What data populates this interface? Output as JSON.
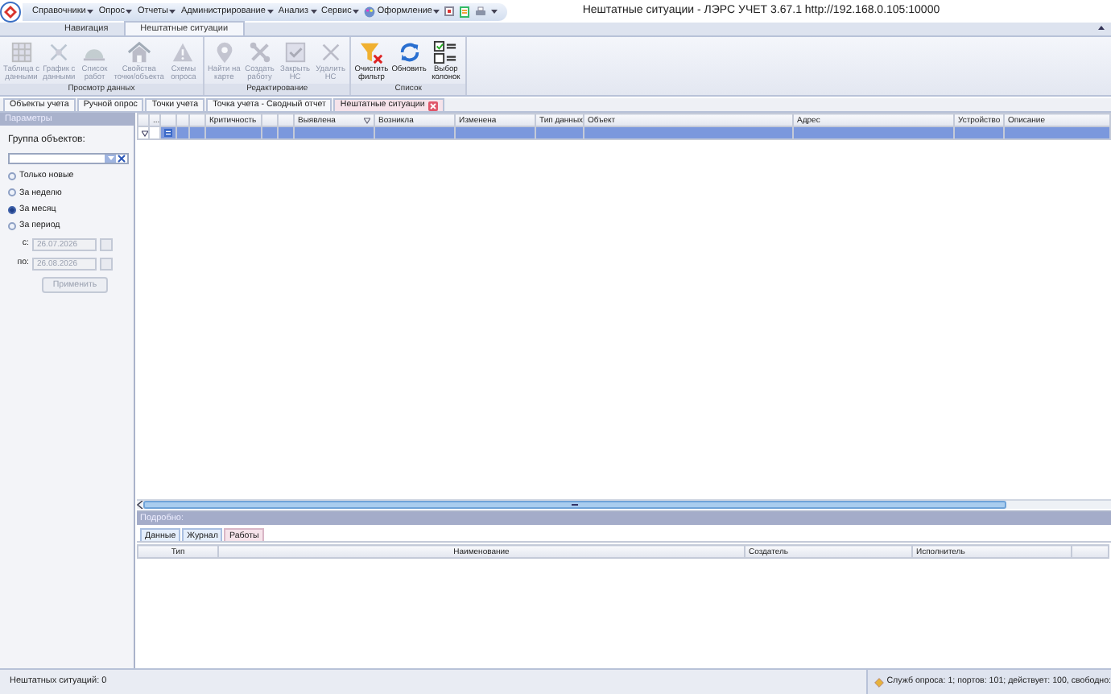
{
  "window": {
    "title": "Нештатные ситуации - ЛЭРС УЧЕТ 3.67.1 http://192.168.0.105:10000"
  },
  "menu": [
    {
      "label": "Справочники"
    },
    {
      "label": "Опрос"
    },
    {
      "label": "Отчеты"
    },
    {
      "label": "Администрирование"
    },
    {
      "label": "Анализ"
    },
    {
      "label": "Сервис"
    },
    {
      "label": "Оформление"
    }
  ],
  "ribbon_tabs": [
    {
      "label": "Навигация",
      "selected": false
    },
    {
      "label": "Нештатные ситуации",
      "selected": true
    }
  ],
  "ribbon_groups": [
    {
      "label": "Просмотр данных",
      "buttons": [
        {
          "label": "Таблица с\nданными",
          "disabled": true
        },
        {
          "label": "График с\nданными",
          "disabled": true
        },
        {
          "label": "Список\nработ",
          "disabled": true
        },
        {
          "label": "Свойства\nточки/объекта",
          "disabled": true
        },
        {
          "label": "Схемы\nопроса",
          "disabled": true
        }
      ]
    },
    {
      "label": "Редактирование",
      "buttons": [
        {
          "label": "Найти на\nкарте",
          "disabled": true
        },
        {
          "label": "Создать\nработу",
          "disabled": true
        },
        {
          "label": "Закрыть\nНС",
          "disabled": true
        },
        {
          "label": "Удалить\nНС",
          "disabled": true
        }
      ]
    },
    {
      "label": "Список",
      "buttons": [
        {
          "label": "Очистить\nфильтр",
          "disabled": false
        },
        {
          "label": "Обновить",
          "disabled": false
        },
        {
          "label": "Выбор\nколонок",
          "disabled": false
        }
      ]
    }
  ],
  "doc_tabs": [
    {
      "label": "Объекты учета",
      "selected": false
    },
    {
      "label": "Ручной опрос",
      "selected": false
    },
    {
      "label": "Точки учета",
      "selected": false
    },
    {
      "label": "Точка учета - Сводный отчет",
      "selected": false
    },
    {
      "label": "Нештатные ситуации",
      "selected": true,
      "closable": true
    }
  ],
  "parameters": {
    "title": "Параметры",
    "group_label": "Группа объектов:",
    "periods": [
      {
        "label": "Только новые",
        "selected": false
      },
      {
        "label": "За неделю",
        "selected": false
      },
      {
        "label": "За месяц",
        "selected": true
      },
      {
        "label": "За период",
        "selected": false
      }
    ],
    "date_from": {
      "label": "с:",
      "value": "26.07.2026",
      "disabled": true
    },
    "date_to": {
      "label": "по:",
      "value": "26.08.2026",
      "disabled": true
    },
    "apply_button": {
      "label": "Применить",
      "disabled": true
    }
  },
  "grid": {
    "columns": [
      {
        "kind": "blank"
      },
      {
        "kind": "text",
        "label": "..."
      },
      {
        "kind": "blank"
      },
      {
        "kind": "blank"
      },
      {
        "kind": "blank"
      },
      {
        "kind": "text",
        "label": "Критичность"
      },
      {
        "kind": "blank"
      },
      {
        "kind": "blank"
      },
      {
        "kind": "text",
        "label": "Выявлена",
        "sorted": true
      },
      {
        "kind": "text",
        "label": "Возникла"
      },
      {
        "kind": "text",
        "label": "Изменена"
      },
      {
        "kind": "text",
        "label": "Тип данных"
      },
      {
        "kind": "text",
        "label": "Объект"
      },
      {
        "kind": "text",
        "label": "Адрес"
      },
      {
        "kind": "text",
        "label": "Устройство"
      },
      {
        "kind": "text",
        "label": "Описание"
      }
    ],
    "filter_row": {
      "selected": true
    }
  },
  "details": {
    "title": "Подробно:",
    "tabs": [
      {
        "label": "Данные",
        "selected": false
      },
      {
        "label": "Журнал",
        "selected": false
      },
      {
        "label": "Работы",
        "selected": true
      }
    ],
    "columns": [
      {
        "label": "Тип"
      },
      {
        "label": "Наименование"
      },
      {
        "label": "Создатель"
      },
      {
        "label": "Исполнитель"
      }
    ]
  },
  "status_bar": {
    "left": "Нештатных ситуаций: 0",
    "right": "Служб опроса: 1; портов: 101; действует: 100, свободно:"
  }
}
